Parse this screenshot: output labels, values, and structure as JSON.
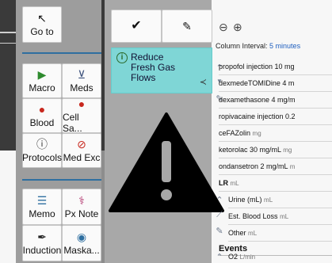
{
  "left_buttons": {
    "goto": "Go to",
    "macro": "Macro",
    "meds": "Meds",
    "blood": "Blood",
    "cell_saver": "Cell Sa...",
    "protocols": "Protocols",
    "med_exc": "Med Exc",
    "memo": "Memo",
    "px_note": "Px Note",
    "induction": "Induction",
    "mask": "Maska..."
  },
  "alert": {
    "text_line1": "Reduce",
    "text_line2": "Fresh Gas",
    "text_line3": "Flows"
  },
  "right_panel": {
    "column_interval_label": "Column Interval:",
    "column_interval_value": "5 minutes",
    "meds": [
      {
        "name": "propofol injection 10 mg",
        "unit": ""
      },
      {
        "name": "dexmedeTOMIDine 4 m",
        "unit": ""
      },
      {
        "name": "dexamethasone 4 mg/m",
        "unit": ""
      },
      {
        "name": "ropivacaine injection 0.2",
        "unit": ""
      },
      {
        "name": "ceFAZolin",
        "unit": "mg"
      },
      {
        "name": "ketorolac 30 mg/mL",
        "unit": "mg"
      },
      {
        "name": "ondansetron 2 mg/mL",
        "unit": "m"
      },
      {
        "name": "LR",
        "unit": "mL"
      }
    ],
    "fluids": [
      {
        "name": "Urine (mL)",
        "unit": "mL"
      },
      {
        "name": "Est. Blood Loss",
        "unit": "mL"
      },
      {
        "name": "Other",
        "unit": "mL"
      }
    ],
    "events_label": "Events",
    "o2": {
      "name": "O2",
      "unit": "L/min"
    }
  },
  "colors": {
    "accent_blue": "#2f6fa0",
    "alert_bg": "#7fd6d6",
    "macro_green": "#2e8b2e",
    "blood_red": "#c8281e",
    "warning_black": "#000000"
  }
}
